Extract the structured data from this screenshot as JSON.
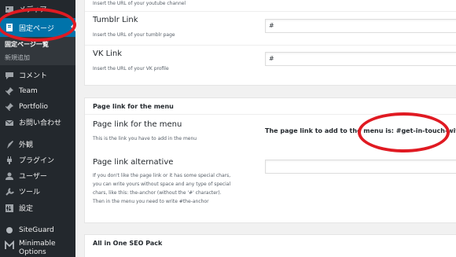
{
  "sidebar": {
    "items": [
      {
        "label": "メディア",
        "icon": "media-icon"
      },
      {
        "label": "固定ページ",
        "icon": "pages-icon"
      },
      {
        "label": "コメント",
        "icon": "comments-icon"
      },
      {
        "label": "Team",
        "icon": "pin-icon"
      },
      {
        "label": "Portfolio",
        "icon": "pin-icon"
      },
      {
        "label": "お問い合わせ",
        "icon": "mail-icon"
      },
      {
        "label": "外観",
        "icon": "appearance-icon"
      },
      {
        "label": "プラグイン",
        "icon": "plugin-icon"
      },
      {
        "label": "ユーザー",
        "icon": "users-icon"
      },
      {
        "label": "ツール",
        "icon": "tools-icon"
      },
      {
        "label": "設定",
        "icon": "settings-icon"
      },
      {
        "label": "SiteGuard",
        "icon": "siteguard-icon"
      },
      {
        "label": "Minimable Options",
        "icon": "minimable-icon"
      }
    ],
    "submenu": [
      "固定ページ一覧",
      "新規追加"
    ]
  },
  "youtube": {
    "desc": "Insert the URL of your youtube channel"
  },
  "tumblr": {
    "label": "Tumblr Link",
    "desc": "Insert the URL of your tumblr page",
    "value": "#"
  },
  "vk": {
    "label": "VK Link",
    "desc": "Insert the URL of your VK profile",
    "value": "#"
  },
  "pagelink": {
    "section_title": "Page link for the menu",
    "label": "Page link for the menu",
    "desc": "This is the link you have to add in the menu",
    "info_prefix": "The page link to add to the menu is:",
    "info_value": "#get-in-touch-with-us",
    "alt_label": "Page link alternative",
    "alt_desc": [
      "If you don't like the page link or it has some special chars,",
      "you can write yours without space and any type of special",
      "chars, like this: the-anchor (without the '#' character).",
      "Then in the menu you need to write #the-anchor"
    ],
    "alt_value": ""
  },
  "seo": {
    "title": "All in One SEO Pack"
  },
  "colors": {
    "sidebar": "#23282d",
    "active": "#0073aa",
    "annotation": "#e01a22"
  }
}
